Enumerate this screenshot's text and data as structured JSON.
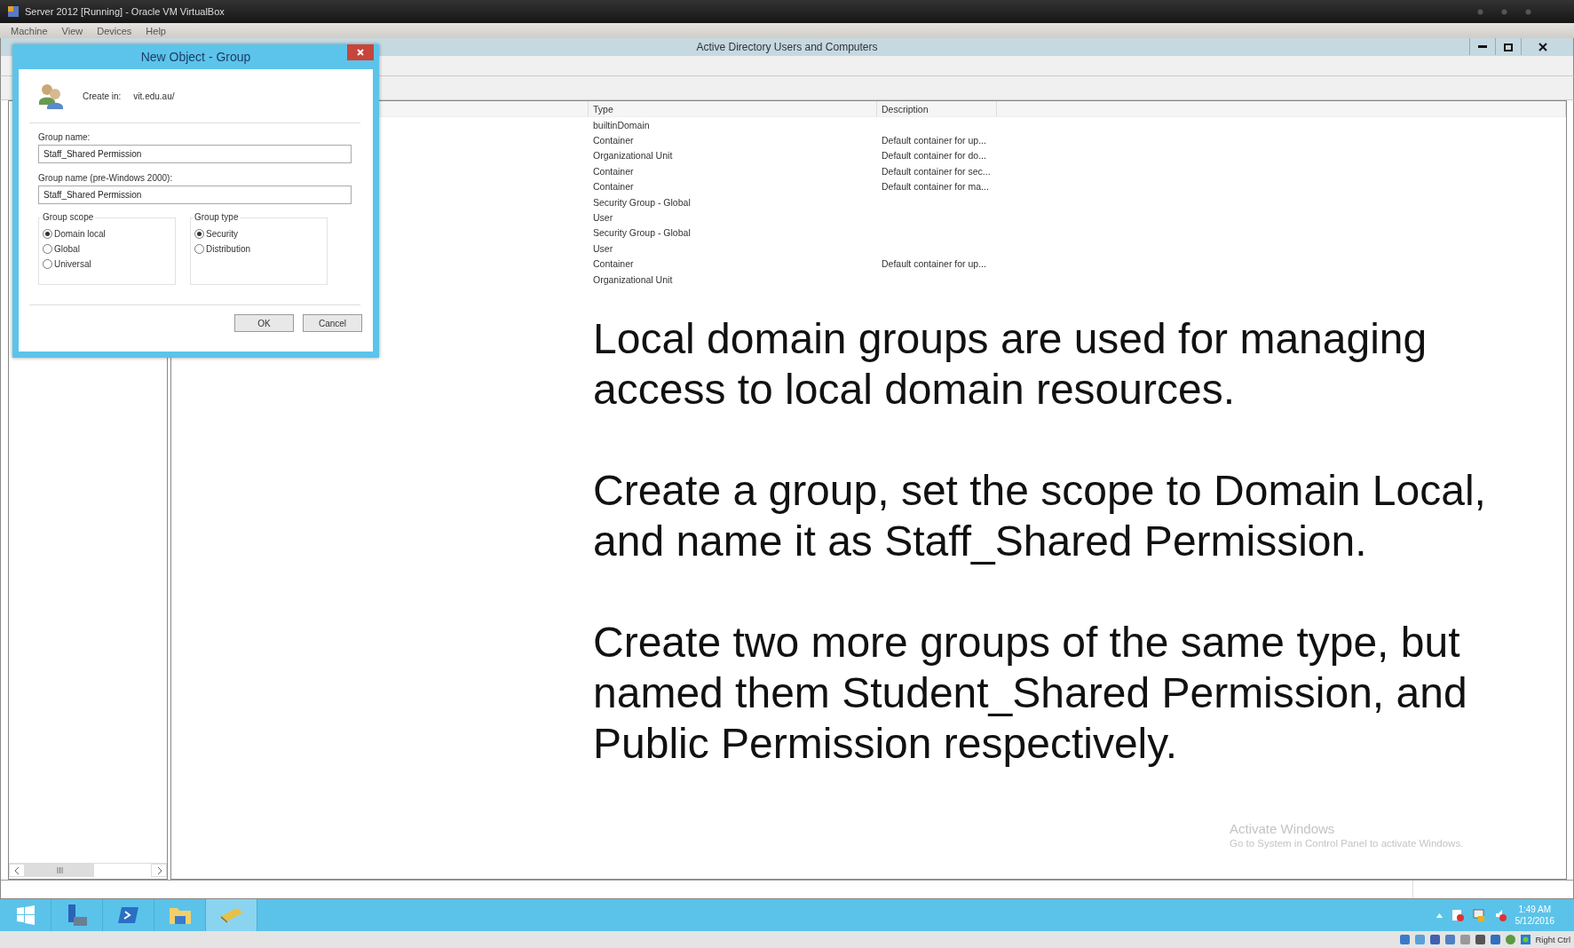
{
  "vm_window": {
    "title": "Server 2012 [Running] - Oracle VM VirtualBox",
    "menu": [
      "Machine",
      "View",
      "Devices",
      "Help"
    ],
    "host_key": "Right Ctrl"
  },
  "app_window": {
    "title": "Active Directory Users and Computers"
  },
  "table": {
    "columns": [
      "Type",
      "Description"
    ],
    "rows": [
      {
        "type": "builtinDomain",
        "description": ""
      },
      {
        "type": "Container",
        "description": "Default container for up..."
      },
      {
        "type": "Organizational Unit",
        "description": "Default container for do..."
      },
      {
        "type": "Container",
        "description": "Default container for sec..."
      },
      {
        "type": "Container",
        "description": "Default container for ma..."
      },
      {
        "type": "Security Group - Global",
        "description": ""
      },
      {
        "type": "User",
        "description": ""
      },
      {
        "type": "Security Group - Global",
        "description": ""
      },
      {
        "type": "User",
        "description": ""
      },
      {
        "type": "Container",
        "description": "Default container for up..."
      },
      {
        "type": "Organizational Unit",
        "description": ""
      }
    ]
  },
  "note": {
    "paragraphs": [
      "Local domain groups are used for managing access to local domain resources.",
      "Create a group, set the scope to Domain Local, and name it as Staff_Shared Permission.",
      "Create two more groups of the same type, but named them Student_Shared Permission, and Public Permission respectively."
    ]
  },
  "activation_notice": {
    "title": "Activate Windows",
    "subtitle": "Go to System in Control Panel to activate Windows."
  },
  "dialog": {
    "title": "New Object - Group",
    "create_in_label": "Create in:",
    "create_in_value": "vit.edu.au/",
    "fields": [
      {
        "label": "Group name:",
        "value": "Staff_Shared Permission"
      },
      {
        "label": "Group name (pre-Windows 2000):",
        "value": "Staff_Shared Permission"
      }
    ],
    "groups": [
      {
        "label": "Group scope",
        "options": [
          {
            "label": "Domain local",
            "selected": true
          },
          {
            "label": "Global",
            "selected": false
          },
          {
            "label": "Universal",
            "selected": false
          }
        ]
      },
      {
        "label": "Group type",
        "options": [
          {
            "label": "Security",
            "selected": true
          },
          {
            "label": "Distribution",
            "selected": false
          }
        ]
      }
    ],
    "buttons": [
      "OK",
      "Cancel"
    ]
  },
  "taskbar": {
    "apps": [
      {
        "kind": "start",
        "selected": false
      },
      {
        "kind": "servers",
        "selected": false
      },
      {
        "kind": "shell",
        "selected": false
      },
      {
        "kind": "folder",
        "selected": false
      },
      {
        "kind": "directory",
        "selected": true
      }
    ],
    "clock": {
      "time": "1:49 AM",
      "date": "5/12/2016"
    }
  }
}
